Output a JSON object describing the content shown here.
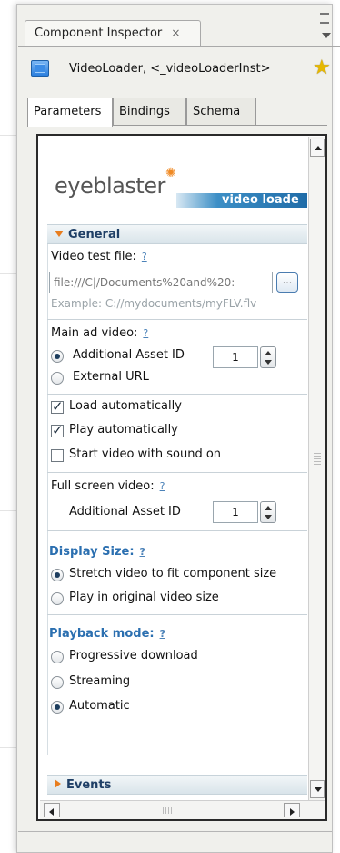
{
  "panel": {
    "tab_title": "Component Inspector",
    "close_glyph": "×",
    "component_name": "VideoLoader, <_videoLoaderInst>",
    "component_icon": "component-icon",
    "favorite_icon": "star-wizard-icon"
  },
  "tabs": [
    {
      "label": "Parameters",
      "active": true
    },
    {
      "label": "Bindings",
      "active": false
    },
    {
      "label": "Schema",
      "active": false
    }
  ],
  "logo": {
    "brand": "eyeblaster",
    "band_text": "video loade",
    "accent_color": "#f08a24"
  },
  "general": {
    "header": "General",
    "video_test_file_label": "Video test file:",
    "help": "?",
    "video_test_file_value": "file:///C|/Documents%20and%20:",
    "browse_label": "...",
    "example": "Example: C://mydocuments/myFLV.flv",
    "main_ad_video_label": "Main ad video:",
    "main_ad_options": [
      "Additional Asset ID",
      "External URL"
    ],
    "main_ad_selected": "Additional Asset ID",
    "main_asset_id": "1",
    "load_automatically": "Load automatically",
    "play_automatically": "Play automatically",
    "start_with_sound": "Start video with sound on",
    "full_screen_label": "Full screen video:",
    "full_screen_asset_label": "Additional Asset ID",
    "full_screen_asset_id": "1",
    "display_size_label": "Display Size:",
    "display_options": [
      "Stretch video to fit component size",
      "Play in original video size"
    ],
    "display_selected": "Stretch video to fit component size",
    "playback_mode_label": "Playback mode:",
    "playback_options": [
      "Progressive download",
      "Streaming",
      "Automatic"
    ],
    "playback_selected": "Automatic"
  },
  "events": {
    "header": "Events"
  },
  "colors": {
    "section_title": "#1f3f66",
    "blue_label": "#2b6fb0",
    "arrow": "#e87d1e"
  }
}
